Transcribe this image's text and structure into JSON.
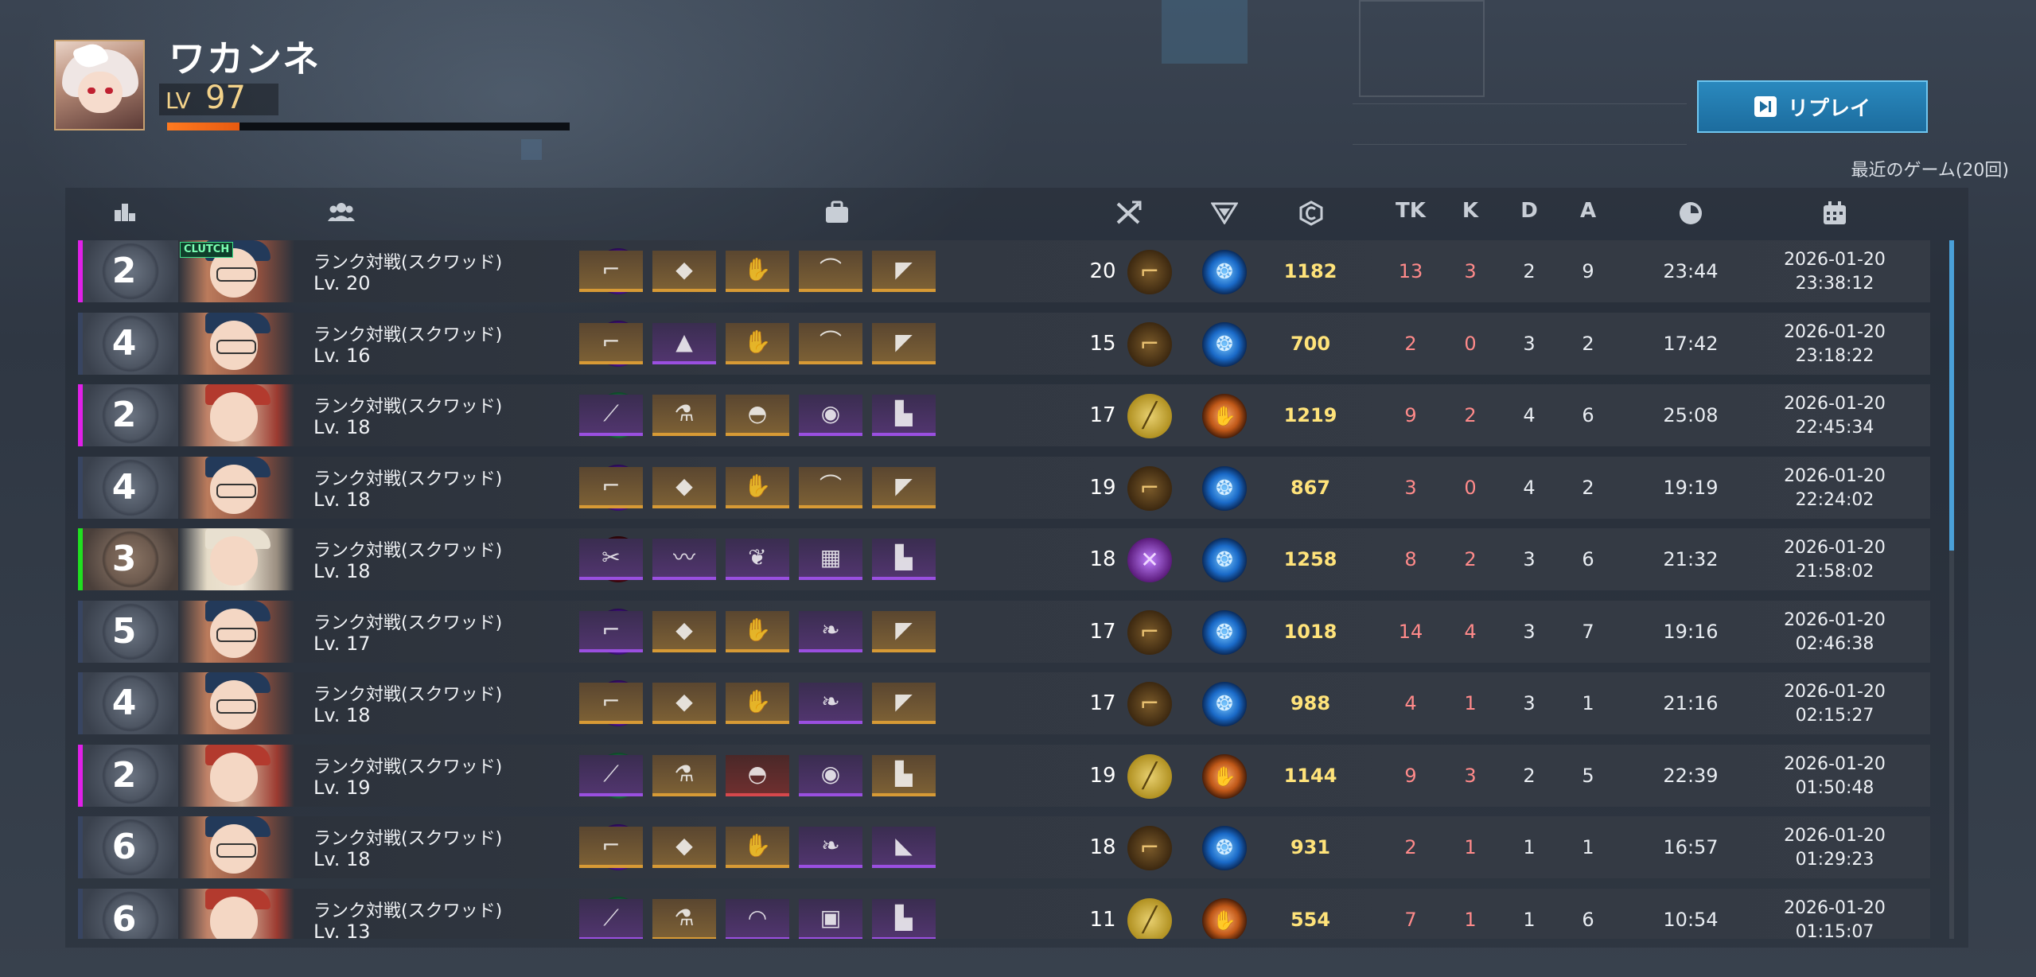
{
  "player": {
    "name": "ワカンネ",
    "level_label": "LV",
    "level": "97",
    "exp_progress": 0.18
  },
  "header": {
    "replay_label": "リプレイ",
    "recent_games_label": "最近のゲーム(20回)"
  },
  "columns": {
    "tk": "TK",
    "k": "K",
    "d": "D",
    "a": "A",
    "icons": [
      "rank-icon",
      "team-icon",
      "equipment-icon",
      "weapon-icon",
      "tactical-skill-icon",
      "credit-icon",
      "time-icon",
      "calendar-icon"
    ]
  },
  "colors": {
    "accent_blue": "#1c6c9e",
    "credit_yellow": "#ffe37a",
    "kill_red": "#ff8a8a",
    "exp_orange": "#ff7a20",
    "bar_magenta": "#e020e8",
    "bar_green": "#20e020",
    "bar_dark": "#3a4866"
  },
  "games": [
    {
      "rank": "2",
      "bar": "magenta",
      "clutch": "CLUTCH",
      "char": "glasses",
      "mode": "ランク対戦(スクワッド)",
      "lv": "Lv. 20",
      "trait": "purple",
      "items": [
        [
          "gold",
          "pistol"
        ],
        [
          "gold",
          "vest"
        ],
        [
          "gold",
          "glove"
        ],
        [
          "gold",
          "necklace"
        ],
        [
          "gold",
          "shoe"
        ]
      ],
      "kills": "20",
      "weapon": "pistol",
      "tactical": "blue",
      "credit": "1182",
      "tk": "13",
      "k": "3",
      "d": "2",
      "a": "9",
      "time": "23:44",
      "date": "2026-01-20",
      "clock": "23:38:12"
    },
    {
      "rank": "4",
      "bar": "dark",
      "clutch": "",
      "char": "glasses",
      "mode": "ランク対戦(スクワッド)",
      "lv": "Lv. 16",
      "trait": "purple",
      "items": [
        [
          "gold",
          "pistol"
        ],
        [
          "purple",
          "cloak"
        ],
        [
          "gold",
          "glove"
        ],
        [
          "gold",
          "necklace"
        ],
        [
          "gold",
          "shoe"
        ]
      ],
      "kills": "15",
      "weapon": "pistol",
      "tactical": "blue",
      "credit": "700",
      "tk": "2",
      "k": "0",
      "d": "3",
      "a": "2",
      "time": "17:42",
      "date": "2026-01-20",
      "clock": "23:18:22"
    },
    {
      "rank": "2",
      "bar": "magenta",
      "clutch": "",
      "char": "redhat",
      "mode": "ランク対戦(スクワッド)",
      "lv": "Lv. 18",
      "trait": "green",
      "items": [
        [
          "purple",
          "knife"
        ],
        [
          "gold",
          "flask"
        ],
        [
          "gold",
          "helmet"
        ],
        [
          "purple",
          "orb"
        ],
        [
          "purple",
          "boots"
        ]
      ],
      "kills": "17",
      "weapon": "knife",
      "tactical": "orange",
      "credit": "1219",
      "tk": "9",
      "k": "2",
      "d": "4",
      "a": "6",
      "time": "25:08",
      "date": "2026-01-20",
      "clock": "22:45:34"
    },
    {
      "rank": "4",
      "bar": "dark",
      "clutch": "",
      "char": "glasses",
      "mode": "ランク対戦(スクワッド)",
      "lv": "Lv. 18",
      "trait": "purple",
      "items": [
        [
          "gold",
          "pistol"
        ],
        [
          "gold",
          "vest"
        ],
        [
          "gold",
          "glove"
        ],
        [
          "gold",
          "necklace"
        ],
        [
          "gold",
          "shoe"
        ]
      ],
      "kills": "19",
      "weapon": "pistol",
      "tactical": "blue",
      "credit": "867",
      "tk": "3",
      "k": "0",
      "d": "4",
      "a": "2",
      "time": "19:19",
      "date": "2026-01-20",
      "clock": "22:24:02"
    },
    {
      "rank": "3",
      "bar": "green",
      "clutch": "",
      "char": "blonde",
      "mode": "ランク対戦(スクワッド)",
      "lv": "Lv. 18",
      "trait": "red",
      "items": [
        [
          "purple",
          "blades"
        ],
        [
          "purple",
          "scarf"
        ],
        [
          "purple",
          "wings"
        ],
        [
          "purple",
          "device"
        ],
        [
          "purple",
          "boots"
        ]
      ],
      "kills": "18",
      "weapon": "blade",
      "tactical": "blue",
      "credit": "1258",
      "tk": "8",
      "k": "2",
      "d": "3",
      "a": "6",
      "time": "21:32",
      "date": "2026-01-20",
      "clock": "21:58:02"
    },
    {
      "rank": "5",
      "bar": "dark",
      "clutch": "",
      "char": "glasses",
      "mode": "ランク対戦(スクワッド)",
      "lv": "Lv. 17",
      "trait": "purple",
      "items": [
        [
          "purple",
          "derringer"
        ],
        [
          "gold",
          "vest"
        ],
        [
          "gold",
          "glove"
        ],
        [
          "purple",
          "feather"
        ],
        [
          "gold",
          "shoe"
        ]
      ],
      "kills": "17",
      "weapon": "pistol",
      "tactical": "blue",
      "credit": "1018",
      "tk": "14",
      "k": "4",
      "d": "3",
      "a": "7",
      "time": "19:16",
      "date": "2026-01-20",
      "clock": "02:46:38"
    },
    {
      "rank": "4",
      "bar": "dark",
      "clutch": "",
      "char": "glasses",
      "mode": "ランク対戦(スクワッド)",
      "lv": "Lv. 18",
      "trait": "purple",
      "items": [
        [
          "gold",
          "pistol"
        ],
        [
          "gold",
          "vest"
        ],
        [
          "gold",
          "glove"
        ],
        [
          "purple",
          "feather"
        ],
        [
          "gold",
          "shoe"
        ]
      ],
      "kills": "17",
      "weapon": "pistol",
      "tactical": "blue",
      "credit": "988",
      "tk": "4",
      "k": "1",
      "d": "3",
      "a": "1",
      "time": "21:16",
      "date": "2026-01-20",
      "clock": "02:15:27"
    },
    {
      "rank": "2",
      "bar": "magenta",
      "clutch": "",
      "char": "redhat",
      "mode": "ランク対戦(スクワッド)",
      "lv": "Lv. 19",
      "trait": "green",
      "items": [
        [
          "purple",
          "knife"
        ],
        [
          "gold",
          "flask"
        ],
        [
          "red",
          "helmet"
        ],
        [
          "purple",
          "orb"
        ],
        [
          "gold",
          "boots"
        ]
      ],
      "kills": "19",
      "weapon": "knife",
      "tactical": "orange",
      "credit": "1144",
      "tk": "9",
      "k": "3",
      "d": "2",
      "a": "5",
      "time": "22:39",
      "date": "2026-01-20",
      "clock": "01:50:48"
    },
    {
      "rank": "6",
      "bar": "dark",
      "clutch": "",
      "char": "glasses",
      "mode": "ランク対戦(スクワッド)",
      "lv": "Lv. 18",
      "trait": "purple",
      "items": [
        [
          "gold",
          "pistol"
        ],
        [
          "gold",
          "vest"
        ],
        [
          "gold",
          "glove"
        ],
        [
          "purple",
          "feather"
        ],
        [
          "purple",
          "sneaker"
        ]
      ],
      "kills": "18",
      "weapon": "pistol",
      "tactical": "blue",
      "credit": "931",
      "tk": "2",
      "k": "1",
      "d": "1",
      "a": "1",
      "time": "16:57",
      "date": "2026-01-20",
      "clock": "01:29:23"
    },
    {
      "rank": "6",
      "bar": "dark",
      "clutch": "",
      "char": "redhat",
      "mode": "ランク対戦(スクワッド)",
      "lv": "Lv. 13",
      "trait": "green",
      "items": [
        [
          "purple",
          "knife"
        ],
        [
          "gold",
          "flask"
        ],
        [
          "purple",
          "headband"
        ],
        [
          "purple",
          "box"
        ],
        [
          "purple",
          "boots"
        ]
      ],
      "kills": "11",
      "weapon": "knife",
      "tactical": "orange",
      "credit": "554",
      "tk": "7",
      "k": "1",
      "d": "1",
      "a": "6",
      "time": "10:54",
      "date": "2026-01-20",
      "clock": "01:15:07"
    }
  ]
}
